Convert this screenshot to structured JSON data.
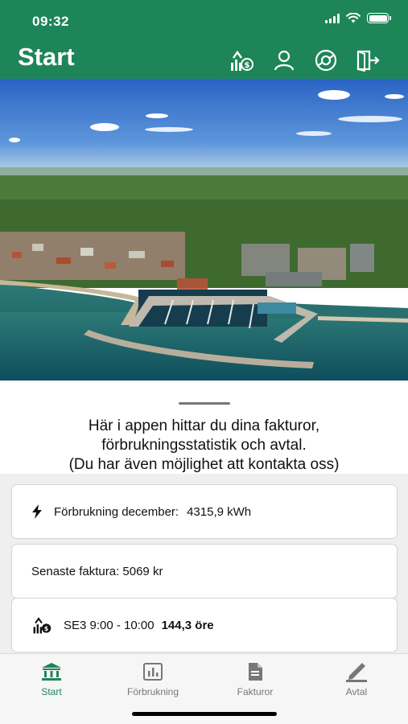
{
  "status_bar": {
    "time": "09:32"
  },
  "header": {
    "title": "Start",
    "actions": [
      {
        "icon": "spot-price-icon"
      },
      {
        "icon": "user-icon"
      },
      {
        "icon": "support-icon"
      },
      {
        "icon": "logout-icon"
      }
    ]
  },
  "intro": {
    "line1": "Här i appen hittar du dina fakturor,",
    "line2": "förbrukningsstatistik och avtal.",
    "line3": "(Du har även möjlighet att kontakta oss)"
  },
  "cards": [
    {
      "icon": "bolt-icon",
      "label": "Förbrukning december:",
      "value": "4315,9 kWh"
    },
    {
      "label": "Senaste faktura: 5069 kr"
    },
    {
      "icon": "spot-price-icon",
      "label": "SE3 9:00 - 10:00",
      "value": "144,3 öre"
    }
  ],
  "tabs": [
    {
      "label": "Start",
      "icon": "bank-icon",
      "active": true
    },
    {
      "label": "Förbrukning",
      "icon": "bar-chart-icon",
      "active": false
    },
    {
      "label": "Fakturor",
      "icon": "document-icon",
      "active": false
    },
    {
      "label": "Avtal",
      "icon": "pen-icon",
      "active": false
    }
  ],
  "colors": {
    "brand": "#1e8559",
    "tab_inactive": "#777777",
    "list_background": "#efefef"
  }
}
